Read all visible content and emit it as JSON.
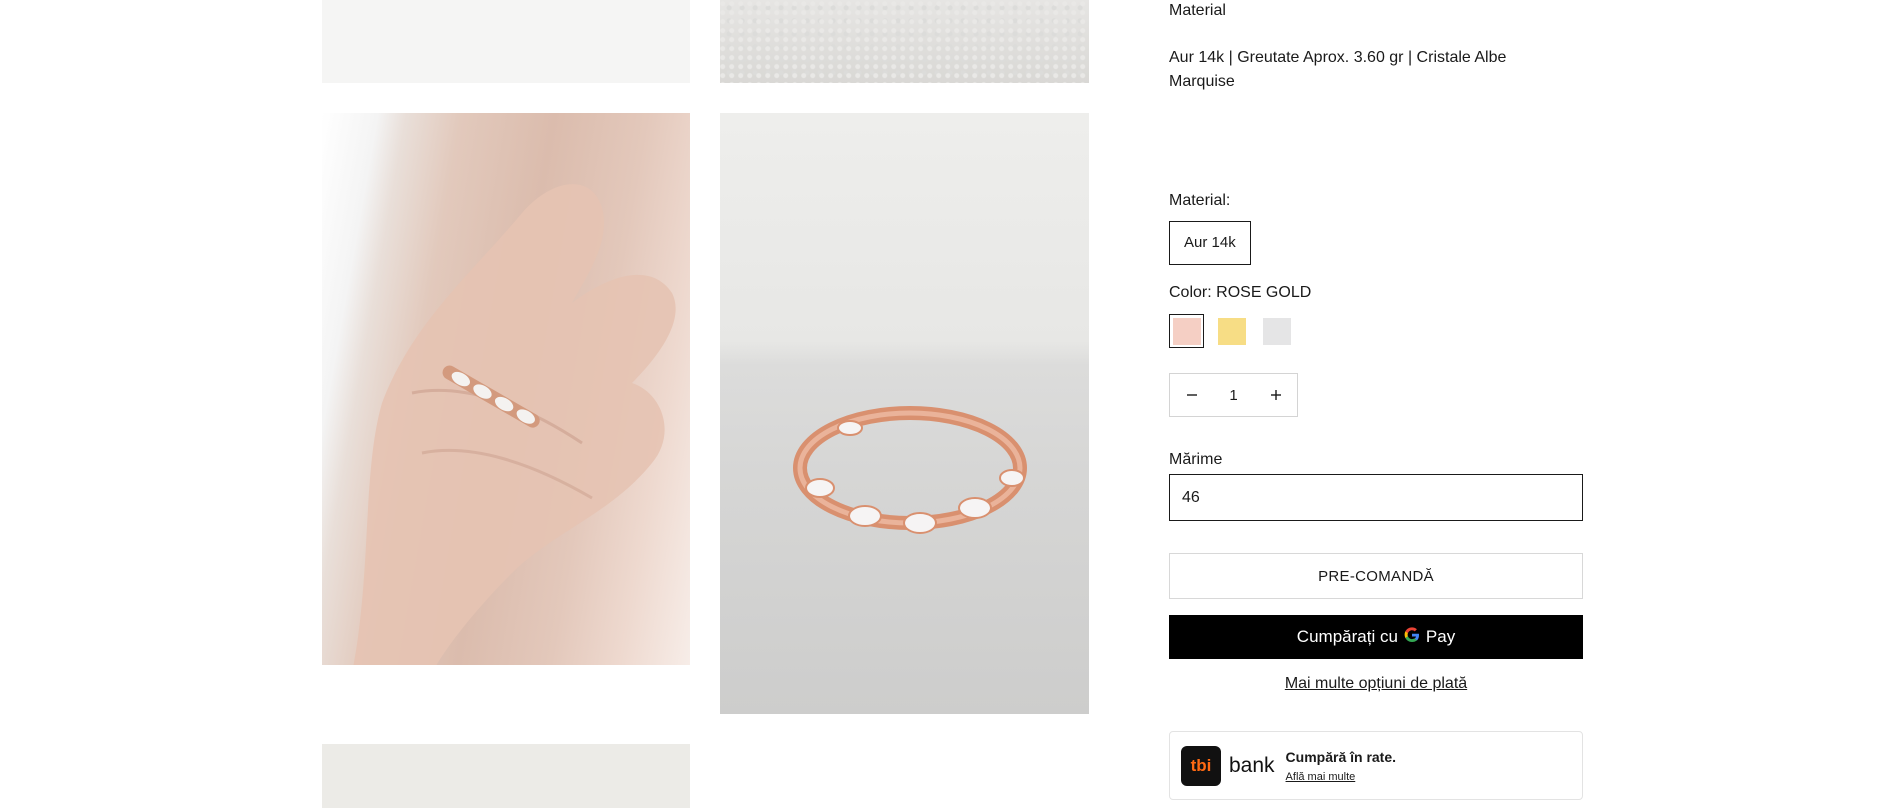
{
  "product": {
    "description_title": "Material",
    "description_text": "Aur 14k | Greutate Aprox. 3.60 gr | Cristale Albe Marquise"
  },
  "options": {
    "material_label": "Material:",
    "material_value": "Aur 14k",
    "color_prefix": "Color:",
    "color_value": "ROSE GOLD",
    "swatches": [
      {
        "name": "rose-gold",
        "color": "#f5cfc4",
        "selected": true
      },
      {
        "name": "yellow-gold",
        "color": "#f7dd85",
        "selected": false
      },
      {
        "name": "white-gold",
        "color": "#e5e5e6",
        "selected": false
      }
    ]
  },
  "quantity": {
    "minus_icon": "minus-icon",
    "value": "1",
    "plus_icon": "plus-icon"
  },
  "size": {
    "label": "Mărime",
    "value": "46"
  },
  "actions": {
    "preorder_label": "PRE-COMANDĂ",
    "gpay_prefix": "Cumpărați cu",
    "gpay_g": "G",
    "gpay_pay": "Pay",
    "more_payment_label": "Mai multe opțiuni de plată"
  },
  "tbi": {
    "logo_text": "tbi",
    "bank_text": "bank",
    "title": "Cumpără în rate.",
    "link": "Află mai multe"
  }
}
